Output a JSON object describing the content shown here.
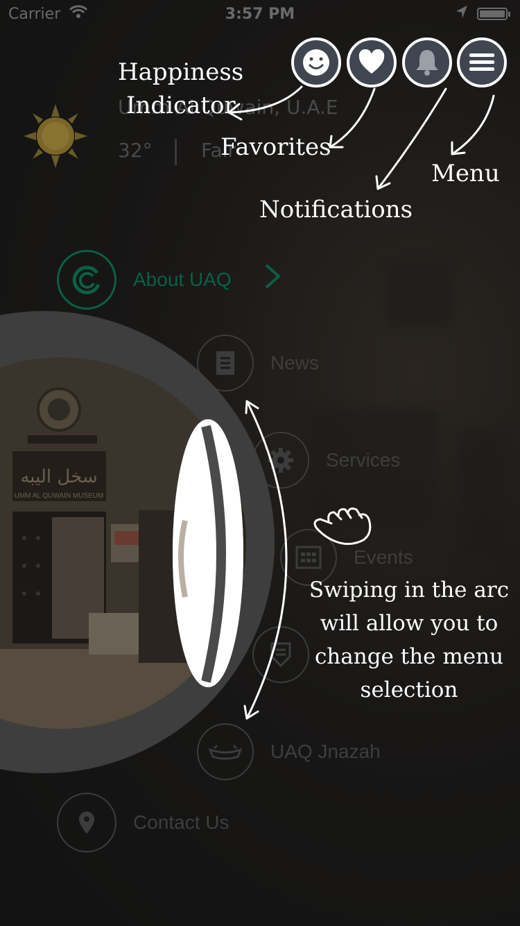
{
  "status_bar": {
    "carrier": "Carrier",
    "time": "3:57 PM"
  },
  "weather": {
    "location": "Umm Al Quwain, U.A.E",
    "temperature": "32°",
    "condition": "Fair"
  },
  "menu": {
    "items": [
      {
        "label": "About UAQ",
        "icon": "uaq-logo-icon",
        "active": true
      },
      {
        "label": "News",
        "icon": "document-icon"
      },
      {
        "label": "Services",
        "icon": "gear-icon"
      },
      {
        "label": "Events",
        "icon": "calendar-icon"
      },
      {
        "label": "",
        "icon": "shield-icon"
      },
      {
        "label": "UAQ Jnazah",
        "icon": "jnazah-icon"
      },
      {
        "label": "Contact Us",
        "icon": "location-pin-icon"
      }
    ]
  },
  "photo": {
    "sign_text": "UMM AL QUWAIN MUSEUM"
  },
  "annotations": {
    "happiness_line1": "Happiness",
    "happiness_line2": "Indicator",
    "favorites": "Favorites",
    "notifications": "Notifications",
    "menu": "Menu",
    "swipe_1": "Swiping in the arc",
    "swipe_2": "will allow you to",
    "swipe_3": "change the menu",
    "swipe_4": "selection"
  },
  "colors": {
    "accent": "#0c5f46",
    "button_bg": "#3f4650",
    "annotation": "#ffffff"
  }
}
